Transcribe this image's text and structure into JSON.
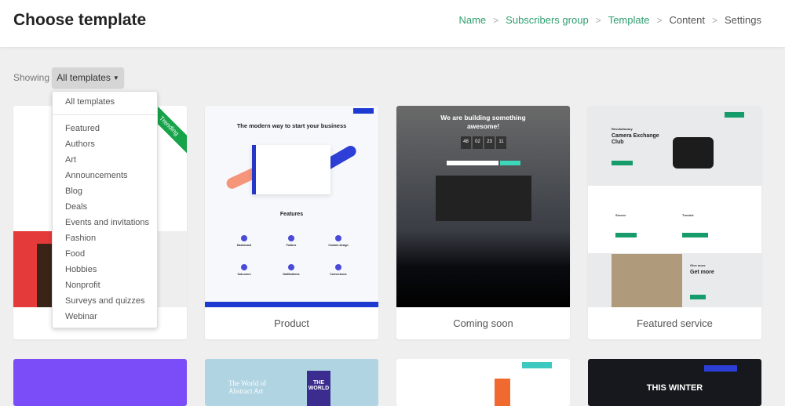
{
  "header": {
    "title": "Choose template",
    "breadcrumb": [
      {
        "label": "Name",
        "done": true
      },
      {
        "label": "Subscribers group",
        "done": true
      },
      {
        "label": "Template",
        "done": true
      },
      {
        "label": "Content",
        "done": false
      },
      {
        "label": "Settings",
        "done": false
      }
    ]
  },
  "filter": {
    "showing_label": "Showing",
    "selected": "All templates",
    "menu": [
      "All templates",
      "Featured",
      "Authors",
      "Art",
      "Announcements",
      "Blog",
      "Deals",
      "Events and invitations",
      "Fashion",
      "Food",
      "Hobbies",
      "Nonprofit",
      "Surveys and quizzes",
      "Webinar"
    ]
  },
  "accent": "#2f9e6e",
  "cards": [
    {
      "label": "",
      "badge": "Trending"
    },
    {
      "label": "Product",
      "headline": "The modern way to start your business",
      "section": "Features",
      "features": [
        "Dashboard",
        "Folders",
        "Custom design",
        "Sub-users",
        "Notifications",
        "Conversions"
      ]
    },
    {
      "label": "Coming soon",
      "headline": "We are building something awesome!",
      "countdown": [
        "48",
        "02",
        "23",
        "11"
      ]
    },
    {
      "label": "Featured service",
      "kicker": "Revolutionary",
      "headline": "Camera Exchange Club",
      "features": [
        "Secure",
        "Trusted"
      ],
      "kicker2": "Give more",
      "headline2": "Get more"
    }
  ],
  "cards_row2": [
    {
      "headline": ""
    },
    {
      "headline": "The World of Abstract Art",
      "book": "THE WORLD"
    },
    {
      "headline": ""
    },
    {
      "headline": "THIS WINTER"
    }
  ]
}
